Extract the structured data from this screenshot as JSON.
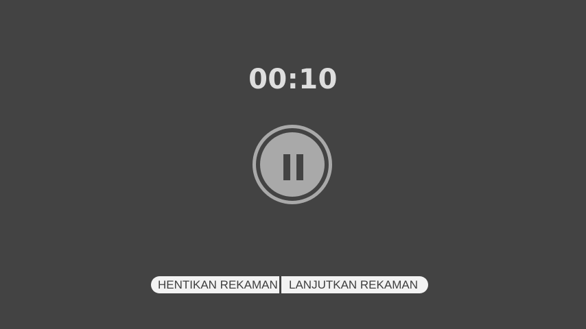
{
  "recording": {
    "elapsed_time": "00:10",
    "pause_icon": "pause-icon"
  },
  "actions": {
    "stop_label": "HENTIKAN REKAMAN",
    "resume_label": "LANJUTKAN REKAMAN"
  },
  "colors": {
    "background": "#434343",
    "timer_text": "#dedede",
    "pause_button": "#a9a9a9",
    "action_button_bg": "#f3f3f3",
    "action_button_text": "#3e3e3e"
  }
}
